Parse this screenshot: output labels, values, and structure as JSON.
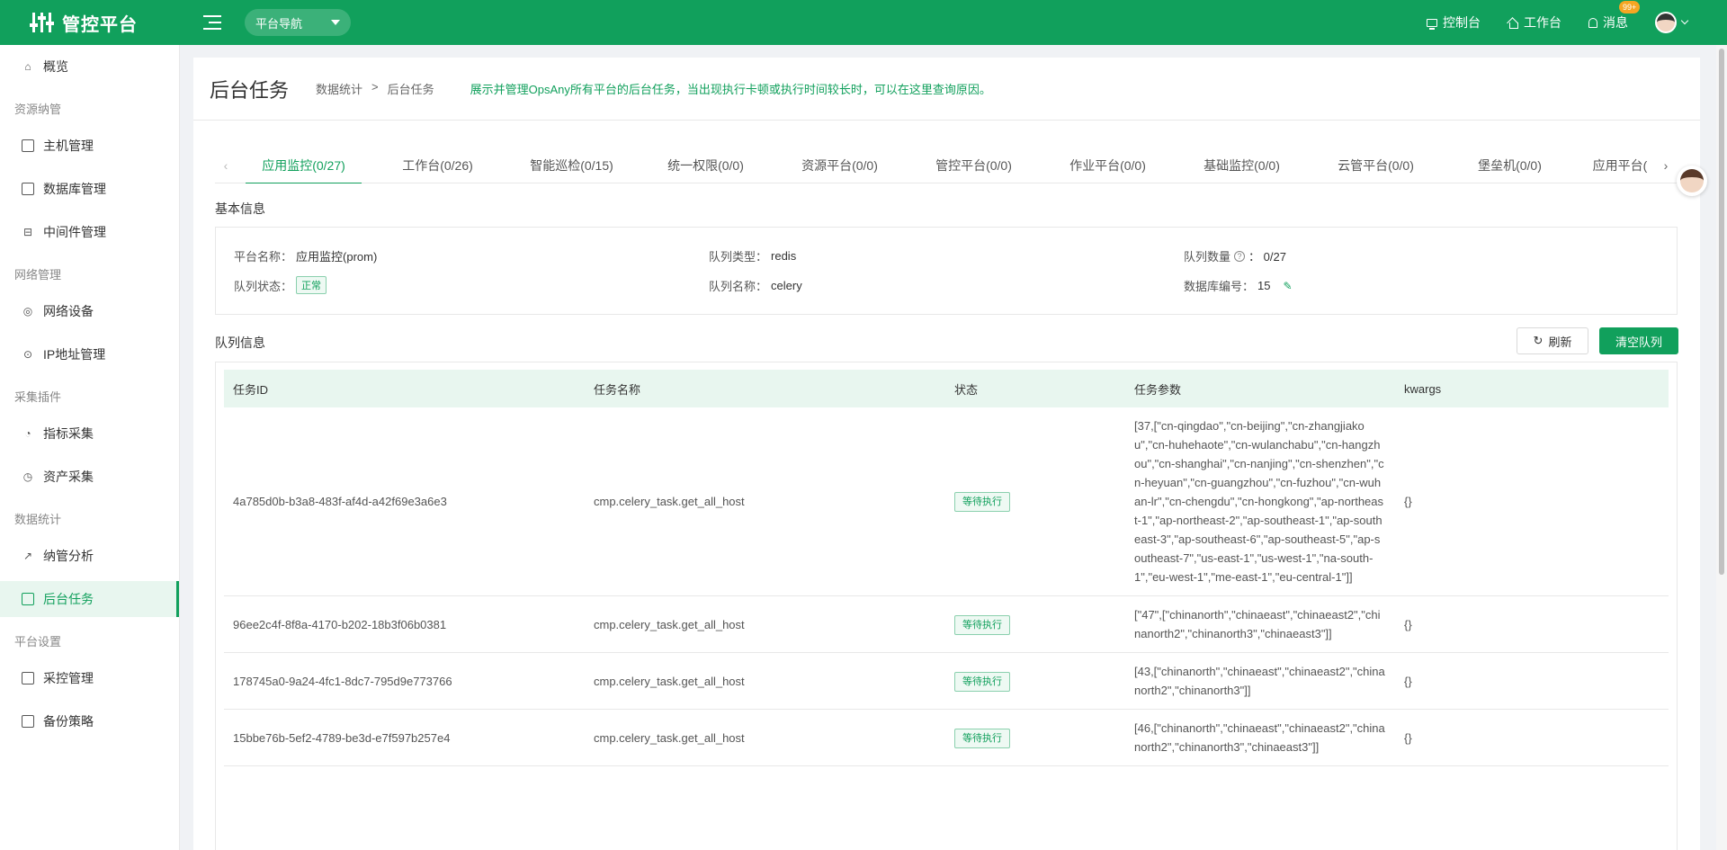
{
  "header": {
    "brand_title": "管控平台",
    "nav_select": "平台导航",
    "links": [
      {
        "label": "控制台",
        "icon": "monitor-icon"
      },
      {
        "label": "工作台",
        "icon": "home-icon"
      },
      {
        "label": "消息",
        "icon": "bell-icon"
      }
    ],
    "badge": "99+"
  },
  "sidebar": {
    "overview": "概览",
    "groups": [
      {
        "title": "资源纳管",
        "items": [
          "主机管理",
          "数据库管理",
          "中间件管理"
        ]
      },
      {
        "title": "网络管理",
        "items": [
          "网络设备",
          "IP地址管理"
        ]
      },
      {
        "title": "采集插件",
        "items": [
          "指标采集",
          "资产采集"
        ]
      },
      {
        "title": "数据统计",
        "items": [
          "纳管分析",
          "后台任务"
        ]
      },
      {
        "title": "平台设置",
        "items": [
          "采控管理",
          "备份策略"
        ]
      }
    ],
    "active_item": "后台任务"
  },
  "page": {
    "title": "后台任务",
    "breadcrumb": [
      "数据统计",
      ">",
      "后台任务"
    ],
    "description": "展示并管理OpsAny所有平台的后台任务，当出现执行卡顿或执行时间较长时，可以在这里查询原因。"
  },
  "tabs": [
    "应用监控(0/27)",
    "工作台(0/26)",
    "智能巡检(0/15)",
    "统一权限(0/0)",
    "资源平台(0/0)",
    "管控平台(0/0)",
    "作业平台(0/0)",
    "基础监控(0/0)",
    "云管平台(0/0)",
    "堡垒机(0/0)",
    "应用平台("
  ],
  "basic_info": {
    "section_title": "基本信息",
    "platform_name_label": "平台名称：",
    "platform_name": "应用监控(prom)",
    "queue_type_label": "队列类型：",
    "queue_type": "redis",
    "queue_count_label": "队列数量",
    "queue_count": "：  0/27",
    "queue_status_label": "队列状态：",
    "queue_status": "正常",
    "queue_name_label": "队列名称：",
    "queue_name": "celery",
    "db_number_label": "数据库编号：",
    "db_number": "15"
  },
  "queue_info": {
    "section_title": "队列信息",
    "refresh_label": "刷新",
    "clear_label": "清空队列",
    "columns": [
      "任务ID",
      "任务名称",
      "状态",
      "任务参数",
      "kwargs"
    ],
    "rows": [
      {
        "id": "4a785d0b-b3a8-483f-af4d-a42f69e3a6e3",
        "name": "cmp.celery_task.get_all_host",
        "status": "等待执行",
        "params": "[37,[\"cn-qingdao\",\"cn-beijing\",\"cn-zhangjiakou\",\"cn-huhehaote\",\"cn-wulanchabu\",\"cn-hangzhou\",\"cn-shanghai\",\"cn-nanjing\",\"cn-shenzhen\",\"cn-heyuan\",\"cn-guangzhou\",\"cn-fuzhou\",\"cn-wuhan-lr\",\"cn-chengdu\",\"cn-hongkong\",\"ap-northeast-1\",\"ap-northeast-2\",\"ap-southeast-1\",\"ap-southeast-3\",\"ap-southeast-6\",\"ap-southeast-5\",\"ap-southeast-7\",\"us-east-1\",\"us-west-1\",\"na-south-1\",\"eu-west-1\",\"me-east-1\",\"eu-central-1\"]]",
        "kwargs": "{}"
      },
      {
        "id": "96ee2c4f-8f8a-4170-b202-18b3f06b0381",
        "name": "cmp.celery_task.get_all_host",
        "status": "等待执行",
        "params": "[\"47\",[\"chinanorth\",\"chinaeast\",\"chinaeast2\",\"chinanorth2\",\"chinanorth3\",\"chinaeast3\"]]",
        "kwargs": "{}"
      },
      {
        "id": "178745a0-9a24-4fc1-8dc7-795d9e773766",
        "name": "cmp.celery_task.get_all_host",
        "status": "等待执行",
        "params": "[43,[\"chinanorth\",\"chinaeast\",\"chinaeast2\",\"chinanorth2\",\"chinanorth3\"]]",
        "kwargs": "{}"
      },
      {
        "id": "15bbe76b-5ef2-4789-be3d-e7f597b257e4",
        "name": "cmp.celery_task.get_all_host",
        "status": "等待执行",
        "params": "[46,[\"chinanorth\",\"chinaeast\",\"chinaeast2\",\"chinanorth2\",\"chinanorth3\",\"chinaeast3\"]]",
        "kwargs": "{}"
      }
    ]
  },
  "colors": {
    "brand": "#11a05c",
    "header_bg": "#11a05c",
    "badge": "#f5a623"
  }
}
